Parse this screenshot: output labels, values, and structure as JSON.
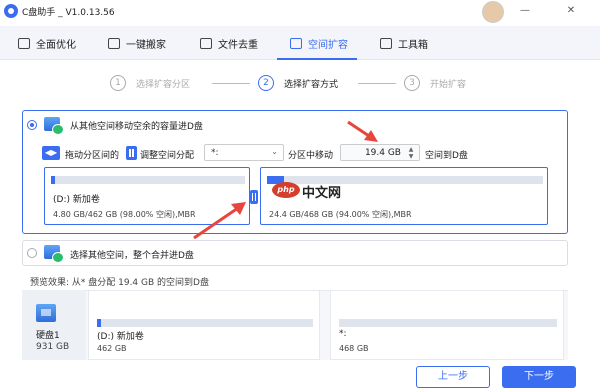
{
  "app": {
    "title": "C盘助手 _ V1.0.13.56",
    "minimize": "—",
    "close": "✕"
  },
  "tabs": [
    {
      "label": "全面优化",
      "icon": "cleanup-icon"
    },
    {
      "label": "一键搬家",
      "icon": "truck-icon"
    },
    {
      "label": "文件去重",
      "icon": "file-dedupe-icon"
    },
    {
      "label": "空间扩容",
      "icon": "expand-space-icon",
      "active": true
    },
    {
      "label": "工具箱",
      "icon": "toolbox-icon"
    }
  ],
  "steps": [
    {
      "num": "1",
      "label": "选择扩容分区"
    },
    {
      "num": "2",
      "label": "选择扩容方式",
      "active": true
    },
    {
      "num": "3",
      "label": "开始扩容"
    }
  ],
  "option1": {
    "title": "从其他空间移动空余的容量进D盘",
    "drag_icon": "◀▶",
    "drag_text": "拖动分区间的",
    "adjust_text": "调整空间分配",
    "source_select": "*:",
    "move_text": "分区中移动",
    "size_value": "19.4 GB",
    "to_text": "空间到D盘",
    "left_partition": {
      "name": "(D:) 新加卷",
      "info": "4.80 GB/462 GB (98.00% 空闲),MBR",
      "used_fraction": 0.02
    },
    "right_partition": {
      "name": "*:",
      "info": "24.4 GB/468 GB (94.00% 空闲),MBR",
      "used_fraction": 0.06
    }
  },
  "watermark": {
    "logo": "php",
    "text": "中文网"
  },
  "option2": {
    "title": "选择其他空间，整个合并进D盘"
  },
  "preview": {
    "label": "预览效果: 从* 盘分配 19.4 GB 的空间到D盘",
    "disk_name": "硬盘1",
    "disk_size": "931 GB",
    "part1": {
      "name": "(D:) 新加卷",
      "size": "462 GB",
      "used_fraction": 0.02
    },
    "part2": {
      "name": "*:",
      "size": "468 GB",
      "used_fraction": 0.0
    }
  },
  "buttons": {
    "prev": "上一步",
    "next": "下一步"
  },
  "colors": {
    "accent": "#3a6df0",
    "arrow": "#e8453c"
  }
}
